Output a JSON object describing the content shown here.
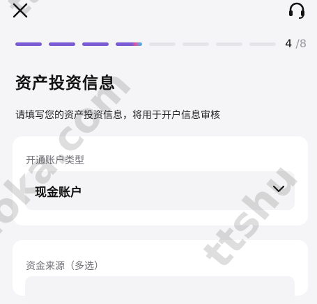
{
  "header": {
    "close_icon": "close-icon",
    "support_icon": "headset-icon"
  },
  "progress": {
    "current": "4",
    "total": "/8",
    "completed_segments": 4,
    "total_segments": 8,
    "accent_color": "#7a5bd4"
  },
  "page": {
    "title": "资产投资信息",
    "subtitle": "请填写您的资产投资信息，将用于开户信息审核"
  },
  "form": {
    "account_type": {
      "label": "开通账户类型",
      "value": "现金账户"
    },
    "fund_source": {
      "label": "资金来源（多选）"
    }
  },
  "watermarks": {
    "text1": "uoka.com",
    "text2": "ttshu",
    "text3": "ttsh"
  }
}
